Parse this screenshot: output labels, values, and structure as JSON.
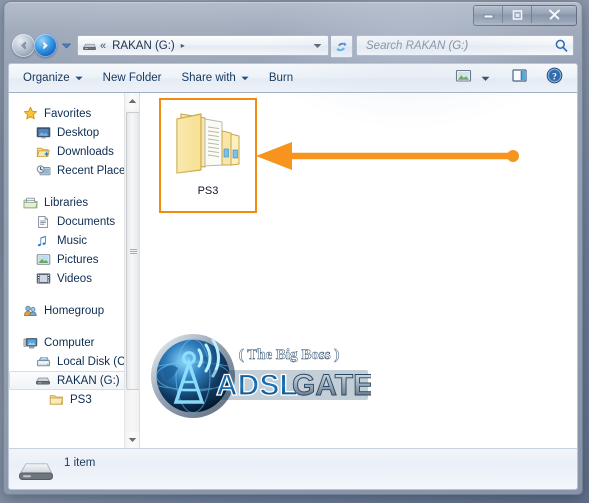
{
  "window": {
    "controls": {
      "minimize_label": "Minimize",
      "maximize_label": "Maximize",
      "close_label": "Close"
    }
  },
  "navigation": {
    "back_label": "Back",
    "forward_label": "Forward",
    "history_label": "Recent pages",
    "refresh_label": "Refresh",
    "address": {
      "overflow": "«",
      "crumb": "RAKAN (G:)",
      "separator": "▸",
      "dropdown": "▾"
    }
  },
  "search": {
    "placeholder": "Search RAKAN (G:)",
    "value": "",
    "icon": "search-icon"
  },
  "toolbar": {
    "items": [
      {
        "label": "Organize",
        "has_dropdown": true
      },
      {
        "label": "New Folder",
        "has_dropdown": false
      },
      {
        "label": "Share with",
        "has_dropdown": true
      },
      {
        "label": "Burn",
        "has_dropdown": false
      }
    ],
    "view_button_label": "Change your view",
    "view_dropdown": "▾",
    "preview_pane_label": "Show the preview pane",
    "help_label": "Get help"
  },
  "sidebar": {
    "groups": [
      {
        "header": {
          "label": "Favorites",
          "icon": "star-icon"
        },
        "items": [
          {
            "label": "Desktop",
            "icon": "desktop-icon"
          },
          {
            "label": "Downloads",
            "icon": "downloads-icon"
          },
          {
            "label": "Recent Place",
            "icon": "recent-places-icon"
          }
        ]
      },
      {
        "header": {
          "label": "Libraries",
          "icon": "libraries-icon"
        },
        "items": [
          {
            "label": "Documents",
            "icon": "document-icon"
          },
          {
            "label": "Music",
            "icon": "music-note-icon"
          },
          {
            "label": "Pictures",
            "icon": "picture-icon"
          },
          {
            "label": "Videos",
            "icon": "video-icon"
          }
        ]
      },
      {
        "header": {
          "label": "Homegroup",
          "icon": "homegroup-icon"
        },
        "items": []
      },
      {
        "header": {
          "label": "Computer",
          "icon": "computer-icon"
        },
        "items": [
          {
            "label": "Local Disk (C",
            "icon": "harddisk-icon",
            "selected": false
          },
          {
            "label": "RAKAN (G:)",
            "icon": "removable-drive-icon",
            "selected": true
          },
          {
            "label": "PS3",
            "icon": "folder-icon",
            "selected": false,
            "depth": 2
          }
        ]
      }
    ],
    "scrollbar": {
      "up_arrow": "▲",
      "down_arrow": "▼"
    }
  },
  "content": {
    "files": [
      {
        "name": "PS3",
        "icon": "open-folder-icon",
        "selected": true
      }
    ]
  },
  "annotation": {
    "type": "arrow",
    "color": "#F7941E",
    "direction": "left",
    "description": "arrow pointing to PS3 folder"
  },
  "watermark": {
    "tagline": "( The Big Boss )",
    "brand_part1": "ADSL",
    "brand_part2": "GATE",
    "brand_full": "ADSLGATE"
  },
  "statusbar": {
    "item_count_text": "1 item",
    "icon": "removable-drive-icon"
  },
  "colors": {
    "annotation_orange": "#F7941E",
    "selection_orange": "#F08A10",
    "accent_blue": "#1668c4",
    "text_dark_blue": "#0d2c52"
  }
}
